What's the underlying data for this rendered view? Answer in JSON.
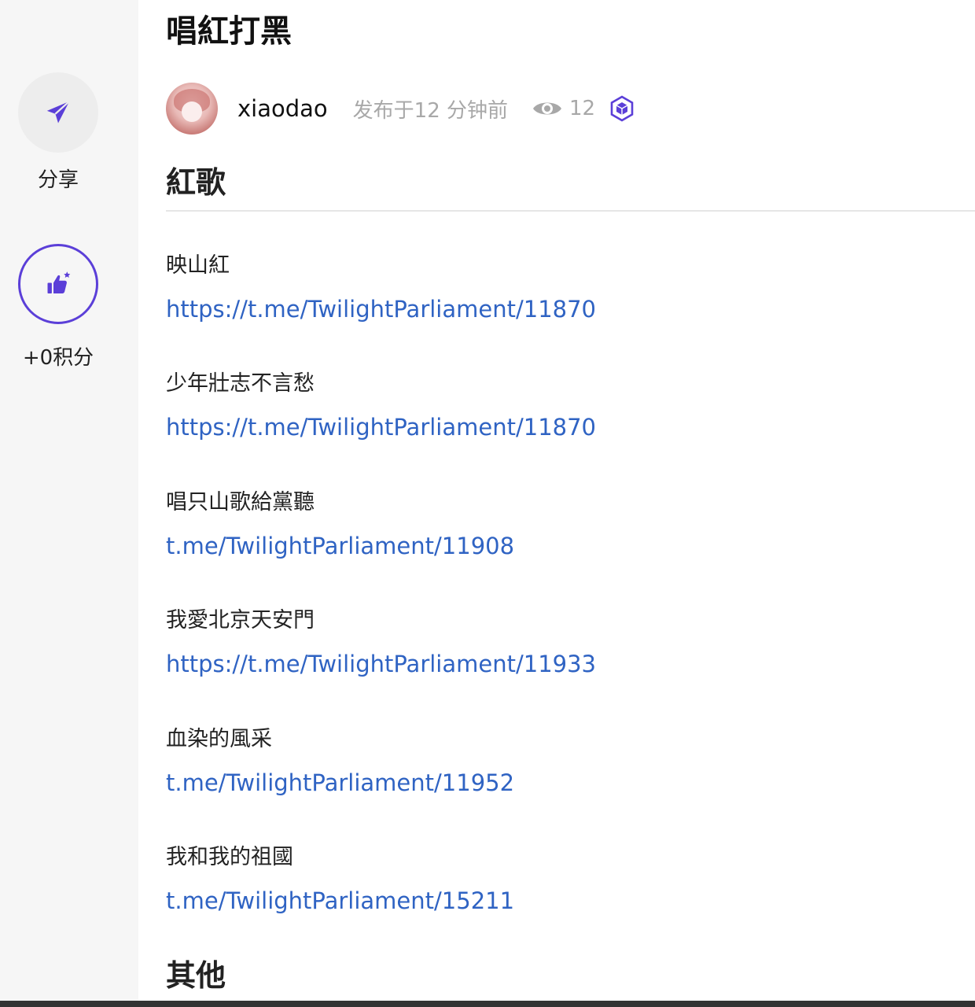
{
  "sidebar": {
    "share_label": "分享",
    "points_label": "+0积分",
    "accent_color": "#5b3fd8"
  },
  "post": {
    "title": "唱紅打黑",
    "author": "xiaodao",
    "posted_time": "发布于12 分钟前",
    "views": "12"
  },
  "sections": {
    "red_songs_heading": "紅歌",
    "other_heading": "其他"
  },
  "songs": [
    {
      "title": "映山紅",
      "link": "https://t.me/TwilightParliament/11870"
    },
    {
      "title": "少年壯志不言愁",
      "link": "https://t.me/TwilightParliament/11870"
    },
    {
      "title": "唱只山歌給黨聽",
      "link": "t.me/TwilightParliament/11908"
    },
    {
      "title": "我愛北京天安門",
      "link": "https://t.me/TwilightParliament/11933"
    },
    {
      "title": "血染的風采",
      "link": "t.me/TwilightParliament/11952"
    },
    {
      "title": "我和我的祖國",
      "link": "t.me/TwilightParliament/15211"
    }
  ],
  "colors": {
    "link": "#2f63c3",
    "muted_text": "#a8a8a8",
    "sidebar_bg": "#f6f6f6"
  }
}
